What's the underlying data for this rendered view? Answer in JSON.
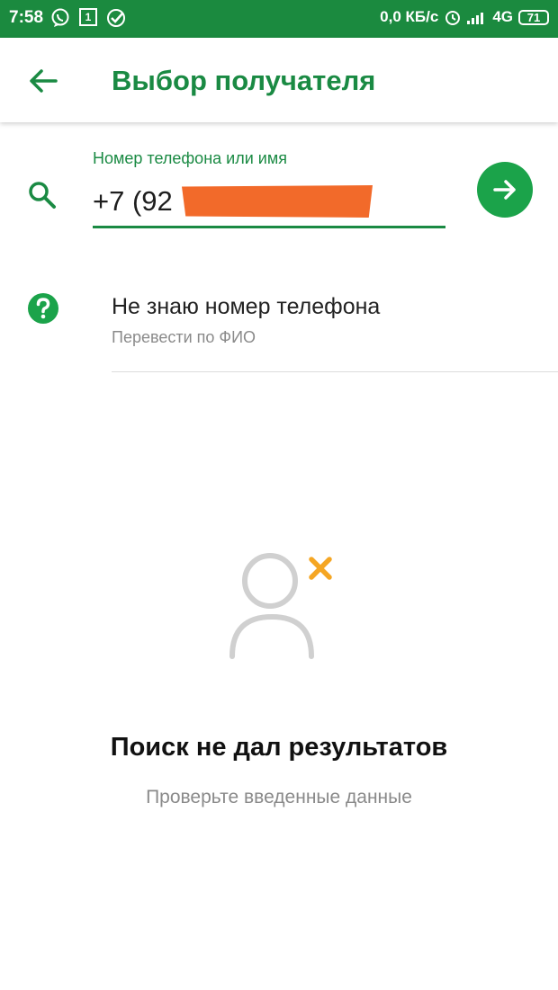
{
  "status_bar": {
    "time": "7:58",
    "sim_badge": "1",
    "net_speed": "0,0 КБ/с",
    "network": "4G",
    "battery": "71"
  },
  "app_bar": {
    "title": "Выбор получателя",
    "back_icon": "arrow-left-icon"
  },
  "search": {
    "label": "Номер телефона или имя",
    "value": "+7 (92",
    "icon": "search-icon",
    "go_icon": "arrow-right-icon"
  },
  "unknown_number": {
    "title": "Не знаю номер телефона",
    "subtitle": "Перевести по ФИО",
    "icon": "help-icon"
  },
  "empty_state": {
    "title": "Поиск не дал результатов",
    "subtitle": "Проверьте введенные данные",
    "illustration": "user-not-found-icon"
  },
  "colors": {
    "brand_green": "#1a8a43",
    "status_bar": "#1b8a3f",
    "accent_orange": "#f5a623",
    "redaction": "#f26a2a"
  }
}
